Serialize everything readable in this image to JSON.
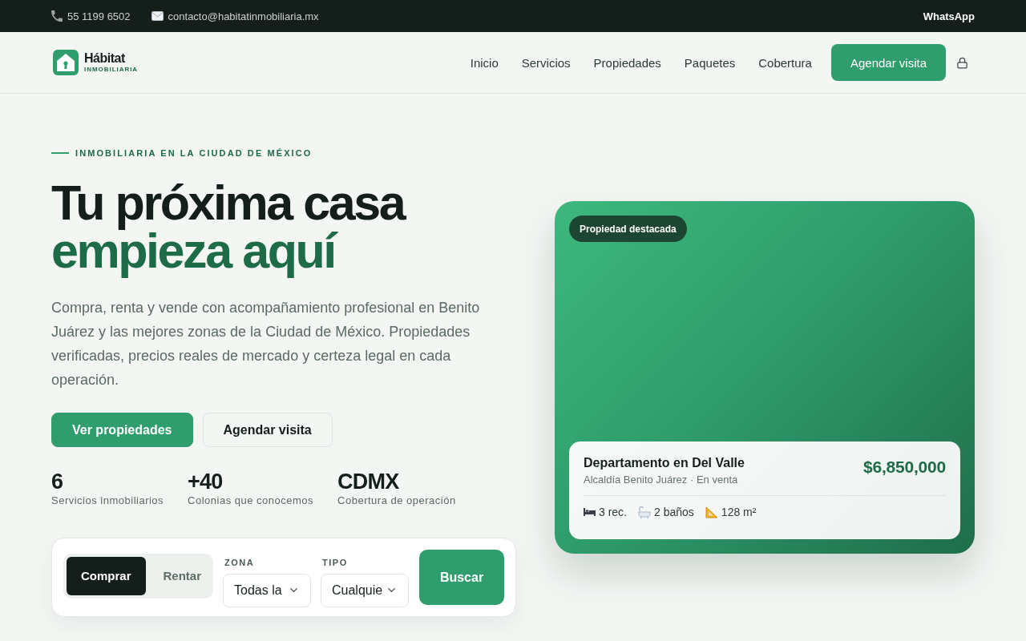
{
  "topbar": {
    "phone": "55 1199 6502",
    "email": "contacto@habitatinmobiliaria.mx",
    "whatsapp": "WhatsApp"
  },
  "nav": {
    "brand": "Hábitat",
    "brand_tagline": "INMOBILIARIA",
    "links": [
      {
        "label": "Inicio"
      },
      {
        "label": "Servicios"
      },
      {
        "label": "Propiedades"
      },
      {
        "label": "Paquetes"
      },
      {
        "label": "Cobertura"
      }
    ],
    "cta": "Agendar visita"
  },
  "hero": {
    "eyebrow": "INMOBILIARIA EN LA CIUDAD DE MÉXICO",
    "title": [
      {
        "text": "Tu próxima casa",
        "kind": "plain"
      },
      {
        "text": "empieza aquí",
        "kind": "accent"
      }
    ],
    "lead": "Compra, renta y vende con acompañamiento profesional en Benito Juárez y las mejores zonas de la Ciudad de México. Propiedades verificadas, precios reales de mercado y certeza legal en cada operación.",
    "buttons": [
      {
        "label": "Ver propiedades",
        "kind": "primary"
      },
      {
        "label": "Agendar visita",
        "kind": "secondary"
      }
    ],
    "stats": [
      {
        "value": "6",
        "label": "Servicios inmobiliarios"
      },
      {
        "value": "+40",
        "label": "Colonias que conocemos"
      },
      {
        "value": "CDMX",
        "label": "Cobertura de operación"
      }
    ]
  },
  "search": {
    "modes": [
      {
        "label": "Comprar",
        "selected": true
      },
      {
        "label": "Rentar",
        "selected": false
      }
    ],
    "fields": [
      {
        "label": "ZONA",
        "value": "Todas la"
      },
      {
        "label": "TIPO",
        "value": "Cualquie"
      }
    ],
    "button": "Buscar"
  },
  "featured": {
    "badge": "Propiedad destacada",
    "title": "Departamento en Del Valle",
    "subtitle": "Alcaldía Benito Juárez · En venta",
    "price": "$6,850,000",
    "features": [
      {
        "kind": "bed",
        "label": "3 rec."
      },
      {
        "kind": "bath",
        "label": "2 baños"
      },
      {
        "kind": "area",
        "label": "128 m²"
      }
    ]
  }
}
